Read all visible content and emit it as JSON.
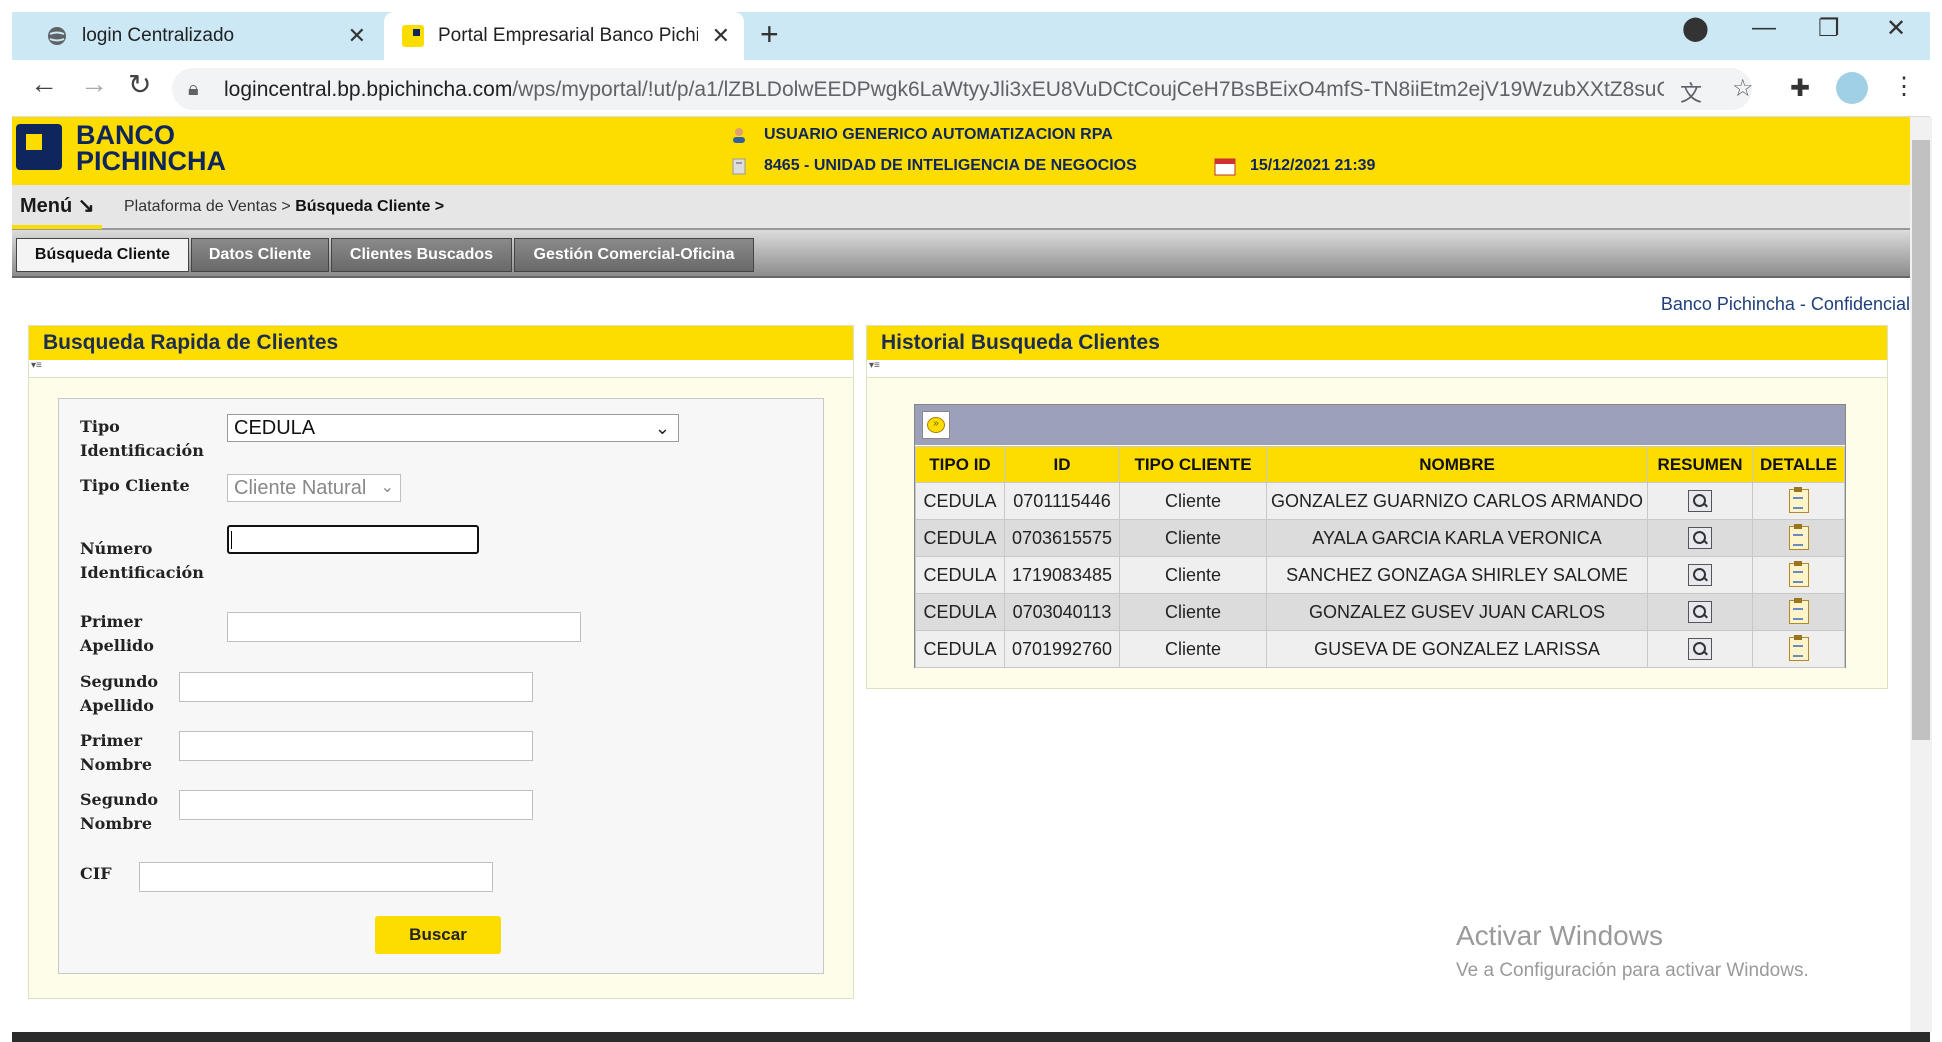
{
  "browser": {
    "tabs": [
      {
        "title": "login Centralizado",
        "active": false
      },
      {
        "title": "Portal Empresarial Banco Pichincha",
        "active": true
      }
    ],
    "url_host": "logincentral.bp.bpichincha.com",
    "url_path": "/wps/myportal/!ut/p/a1/lZBLDolwEEDPwgk6LaWtyyJli3xEU8VuDCtCoujCeH7BsBEixO4mfS-TN8iiEtm2ejV19WzubXXtZ8suQ..."
  },
  "bank": {
    "logo_line1": "BANCO",
    "logo_line2": "PICHINCHA",
    "user": "USUARIO GENERICO AUTOMATIZACION RPA",
    "unit": "8465 - UNIDAD DE INTELIGENCIA DE NEGOCIOS",
    "datetime": "15/12/2021 21:39",
    "menu_label": "Menú ↘",
    "breadcrumb_root": "Plataforma de Ventas > ",
    "breadcrumb_current": "Búsqueda Cliente >",
    "confidential": "Banco Pichincha - Confidencial",
    "brand_color": "#fddc00",
    "navy": "#0f265c"
  },
  "nav_tabs": [
    {
      "label": "Búsqueda Cliente",
      "active": true
    },
    {
      "label": "Datos Cliente",
      "active": false
    },
    {
      "label": "Clientes Buscados",
      "active": false
    },
    {
      "label": "Gestión Comercial-Oficina",
      "active": false
    }
  ],
  "search_panel": {
    "title": "Busqueda Rapida de Clientes",
    "tipo_identificacion_label": [
      "Tipo",
      "Identificación"
    ],
    "tipo_identificacion_value": "CEDULA",
    "tipo_cliente_label": "Tipo Cliente",
    "tipo_cliente_value": "Cliente Natural",
    "numero_label": [
      "Número",
      "Identificación"
    ],
    "primer_apellido_label": [
      "Primer",
      "Apellido"
    ],
    "segundo_apellido_label": [
      "Segundo",
      "Apellido"
    ],
    "primer_nombre_label": [
      "Primer",
      "Nombre"
    ],
    "segundo_nombre_label": [
      "Segundo",
      "Nombre"
    ],
    "cif_label": "CIF",
    "button": "Buscar"
  },
  "history_panel": {
    "title": "Historial Busqueda Clientes",
    "headers": [
      "TIPO ID",
      "ID",
      "TIPO CLIENTE",
      "NOMBRE",
      "RESUMEN",
      "DETALLE"
    ],
    "rows": [
      {
        "tipo_id": "CEDULA",
        "id": "0701115446",
        "tipo_cliente": "Cliente",
        "nombre": "GONZALEZ GUARNIZO CARLOS ARMANDO"
      },
      {
        "tipo_id": "CEDULA",
        "id": "0703615575",
        "tipo_cliente": "Cliente",
        "nombre": "AYALA GARCIA KARLA VERONICA"
      },
      {
        "tipo_id": "CEDULA",
        "id": "1719083485",
        "tipo_cliente": "Cliente",
        "nombre": "SANCHEZ GONZAGA SHIRLEY SALOME"
      },
      {
        "tipo_id": "CEDULA",
        "id": "0703040113",
        "tipo_cliente": "Cliente",
        "nombre": "GONZALEZ GUSEV JUAN CARLOS"
      },
      {
        "tipo_id": "CEDULA",
        "id": "0701992760",
        "tipo_cliente": "Cliente",
        "nombre": "GUSEVA DE GONZALEZ LARISSA"
      }
    ]
  },
  "watermark": {
    "line1": "Activar Windows",
    "line2": "Ve a Configuración para activar Windows."
  }
}
